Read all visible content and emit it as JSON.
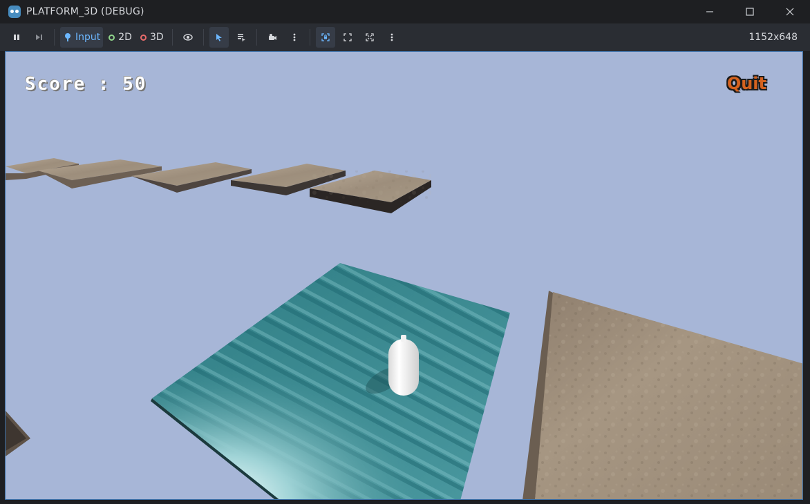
{
  "window": {
    "title": "PLATFORM_3D (DEBUG)",
    "controls": [
      "minimize",
      "maximize",
      "close"
    ]
  },
  "toolbar": {
    "input_label": "Input",
    "mode_2d_label": "2D",
    "mode_3d_label": "3D",
    "resolution": "1152x648",
    "colors": {
      "accent": "#6cb7ff",
      "dot_2d": "#8fd48a",
      "dot_3d": "#e86b6b"
    }
  },
  "game": {
    "score_label": "Score : 50",
    "quit_label": "Quit",
    "colors": {
      "sky": "#a7b6d7",
      "platform_stone": "#a89a88",
      "platform_teal": "#3f8b92",
      "player": "#f4f4f4",
      "quit_text": "#d4621f"
    }
  }
}
